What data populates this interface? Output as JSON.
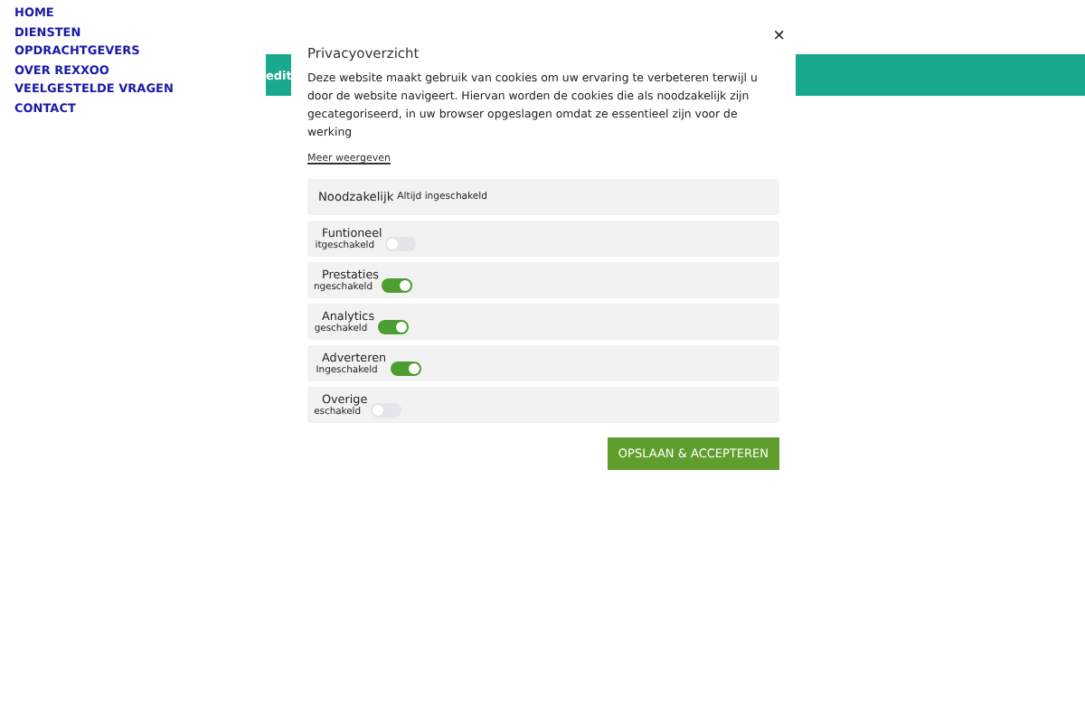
{
  "nav": [
    "HOME",
    "DIENSTEN",
    "OPDRACHTGEVERS",
    "OVER REXXOO",
    "VEELGESTELDE VRAGEN",
    "CONTACT"
  ],
  "banner": {
    "text": "edit"
  },
  "modal": {
    "close": "×",
    "title": "Privacyoverzicht",
    "body": "Deze website maakt gebruik van cookies om uw ervaring te verbeteren terwijl u door de website navigeert. Hiervan worden de cookies die als noodzakelijk zijn gecategoriseerd, in uw browser opgeslagen omdat ze essentieel zijn voor de werking",
    "more": "Meer weergeven",
    "categories": [
      {
        "kind": "fixed",
        "title": "Noodzakelijk",
        "status": "Altijd ingeschakeld"
      },
      {
        "kind": "toggle",
        "title": "Funtioneel",
        "status": "itgeschakeld",
        "on": false
      },
      {
        "kind": "toggle",
        "title": "Prestaties",
        "status": "ngeschakeld",
        "on": true
      },
      {
        "kind": "toggle",
        "title": "Analytics",
        "status": "geschakeld",
        "on": true
      },
      {
        "kind": "toggle",
        "title": "Adverteren",
        "status": "Ingeschakeld",
        "on": true
      },
      {
        "kind": "toggle",
        "title": "Overige",
        "status": "eschakeld",
        "on": false
      }
    ],
    "button": "OPSLAAN & ACCEPTEREN"
  }
}
